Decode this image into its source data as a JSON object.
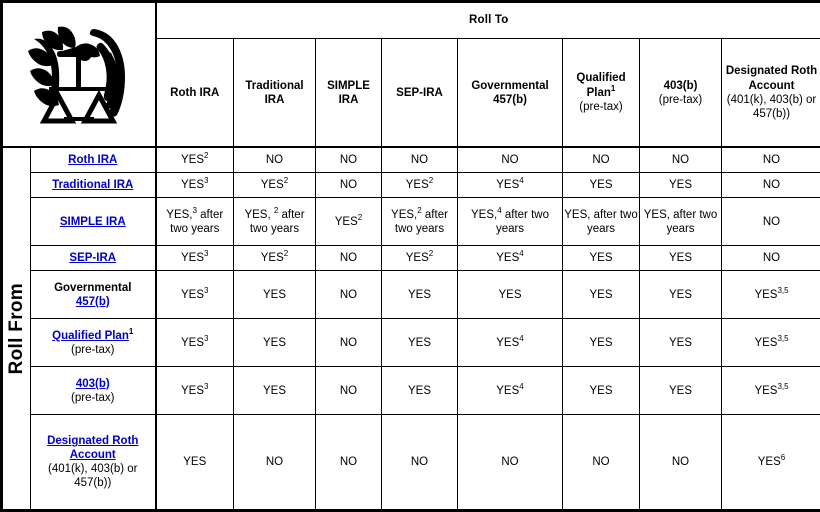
{
  "logo": {
    "icon": "irs-eagle-scales-logo",
    "alt": "Internal Revenue Service seal"
  },
  "headers": {
    "roll_to": "Roll To",
    "roll_from": "Roll From"
  },
  "columns": [
    {
      "id": "roth-ira",
      "label": "Roth IRA",
      "sub": ""
    },
    {
      "id": "traditional-ira",
      "label": "Traditional IRA",
      "sub": ""
    },
    {
      "id": "simple-ira",
      "label": "SIMPLE IRA",
      "sub": ""
    },
    {
      "id": "sep-ira",
      "label": "SEP-IRA",
      "sub": ""
    },
    {
      "id": "governmental-457b",
      "label": "Governmental 457(b)",
      "sub": ""
    },
    {
      "id": "qualified-plan",
      "label": "Qualified Plan",
      "footnote": "1",
      "sub": "(pre-tax)"
    },
    {
      "id": "403b",
      "label": "403(b)",
      "sub": "(pre-tax)"
    },
    {
      "id": "designated-roth-account",
      "label": "Designated Roth Account",
      "sub": "(401(k), 403(b) or 457(b))"
    }
  ],
  "rows": [
    {
      "id": "roth-ira",
      "label": "Roth IRA",
      "link": true,
      "sub": "",
      "cells": [
        {
          "text": "YES",
          "footnote": "2"
        },
        {
          "text": "NO"
        },
        {
          "text": "NO"
        },
        {
          "text": "NO"
        },
        {
          "text": "NO"
        },
        {
          "text": "NO"
        },
        {
          "text": "NO"
        },
        {
          "text": "NO"
        }
      ]
    },
    {
      "id": "traditional-ira",
      "label": "Traditional IRA",
      "link": true,
      "sub": "",
      "cells": [
        {
          "text": "YES",
          "footnote": "3"
        },
        {
          "text": "YES",
          "footnote": "2"
        },
        {
          "text": "NO"
        },
        {
          "text": "YES",
          "footnote": "2"
        },
        {
          "text": "YES",
          "footnote": "4"
        },
        {
          "text": "YES"
        },
        {
          "text": "YES"
        },
        {
          "text": "NO"
        }
      ]
    },
    {
      "id": "simple-ira",
      "label": "SIMPLE IRA",
      "link": true,
      "sub": "",
      "cells": [
        {
          "text": "YES,",
          "footnote": "3",
          "after": " after two years"
        },
        {
          "text": "YES, ",
          "footnote": "2",
          "after": " after two years"
        },
        {
          "text": "YES",
          "footnote": "2"
        },
        {
          "text": "YES,",
          "footnote": "2",
          "after": " after two years"
        },
        {
          "text": "YES,",
          "footnote": "4",
          "after": " after two years"
        },
        {
          "text": "YES, after two years"
        },
        {
          "text": "YES, after two years"
        },
        {
          "text": "NO"
        }
      ]
    },
    {
      "id": "sep-ira",
      "label": "SEP-IRA",
      "link": true,
      "sub": "",
      "cells": [
        {
          "text": "YES",
          "footnote": "3"
        },
        {
          "text": "YES",
          "footnote": "2"
        },
        {
          "text": "NO"
        },
        {
          "text": "YES",
          "footnote": "2"
        },
        {
          "text": "YES",
          "footnote": "4"
        },
        {
          "text": "YES"
        },
        {
          "text": "YES"
        },
        {
          "text": "NO"
        }
      ]
    },
    {
      "id": "governmental-457b",
      "label": "Governmental",
      "link": false,
      "link_sub": "457(b)",
      "sub": "",
      "cells": [
        {
          "text": "YES",
          "footnote": "3"
        },
        {
          "text": "YES"
        },
        {
          "text": "NO"
        },
        {
          "text": "YES"
        },
        {
          "text": "YES"
        },
        {
          "text": "YES"
        },
        {
          "text": "YES"
        },
        {
          "text": "YES",
          "footnote": "3,5"
        }
      ]
    },
    {
      "id": "qualified-plan",
      "label": "Qualified Plan",
      "link": true,
      "footnote": "1",
      "sub": "(pre-tax)",
      "cells": [
        {
          "text": "YES",
          "footnote": "3"
        },
        {
          "text": "YES"
        },
        {
          "text": "NO"
        },
        {
          "text": "YES"
        },
        {
          "text": "YES",
          "footnote": "4"
        },
        {
          "text": "YES"
        },
        {
          "text": "YES"
        },
        {
          "text": "YES",
          "footnote": "3,5"
        }
      ]
    },
    {
      "id": "403b",
      "label": "403(b)",
      "link": true,
      "sub": "(pre-tax)",
      "cells": [
        {
          "text": "YES",
          "footnote": "3"
        },
        {
          "text": "YES"
        },
        {
          "text": "NO"
        },
        {
          "text": "YES"
        },
        {
          "text": "YES",
          "footnote": "4"
        },
        {
          "text": "YES"
        },
        {
          "text": "YES"
        },
        {
          "text": "YES",
          "footnote": "3,5"
        }
      ]
    },
    {
      "id": "designated-roth-account",
      "label": "Designated Roth Account",
      "link": true,
      "sub": "(401(k), 403(b) or 457(b))",
      "cells": [
        {
          "text": "YES"
        },
        {
          "text": "NO"
        },
        {
          "text": "NO"
        },
        {
          "text": "NO"
        },
        {
          "text": "NO"
        },
        {
          "text": "NO"
        },
        {
          "text": "NO"
        },
        {
          "text": "YES",
          "footnote": "6"
        }
      ]
    }
  ],
  "colors": {
    "banner_blue": "#c5d5ed",
    "header_gray": "#f0f0f0",
    "link_blue": "#0000cc",
    "border": "#000000",
    "cell_white": "#ffffff"
  }
}
